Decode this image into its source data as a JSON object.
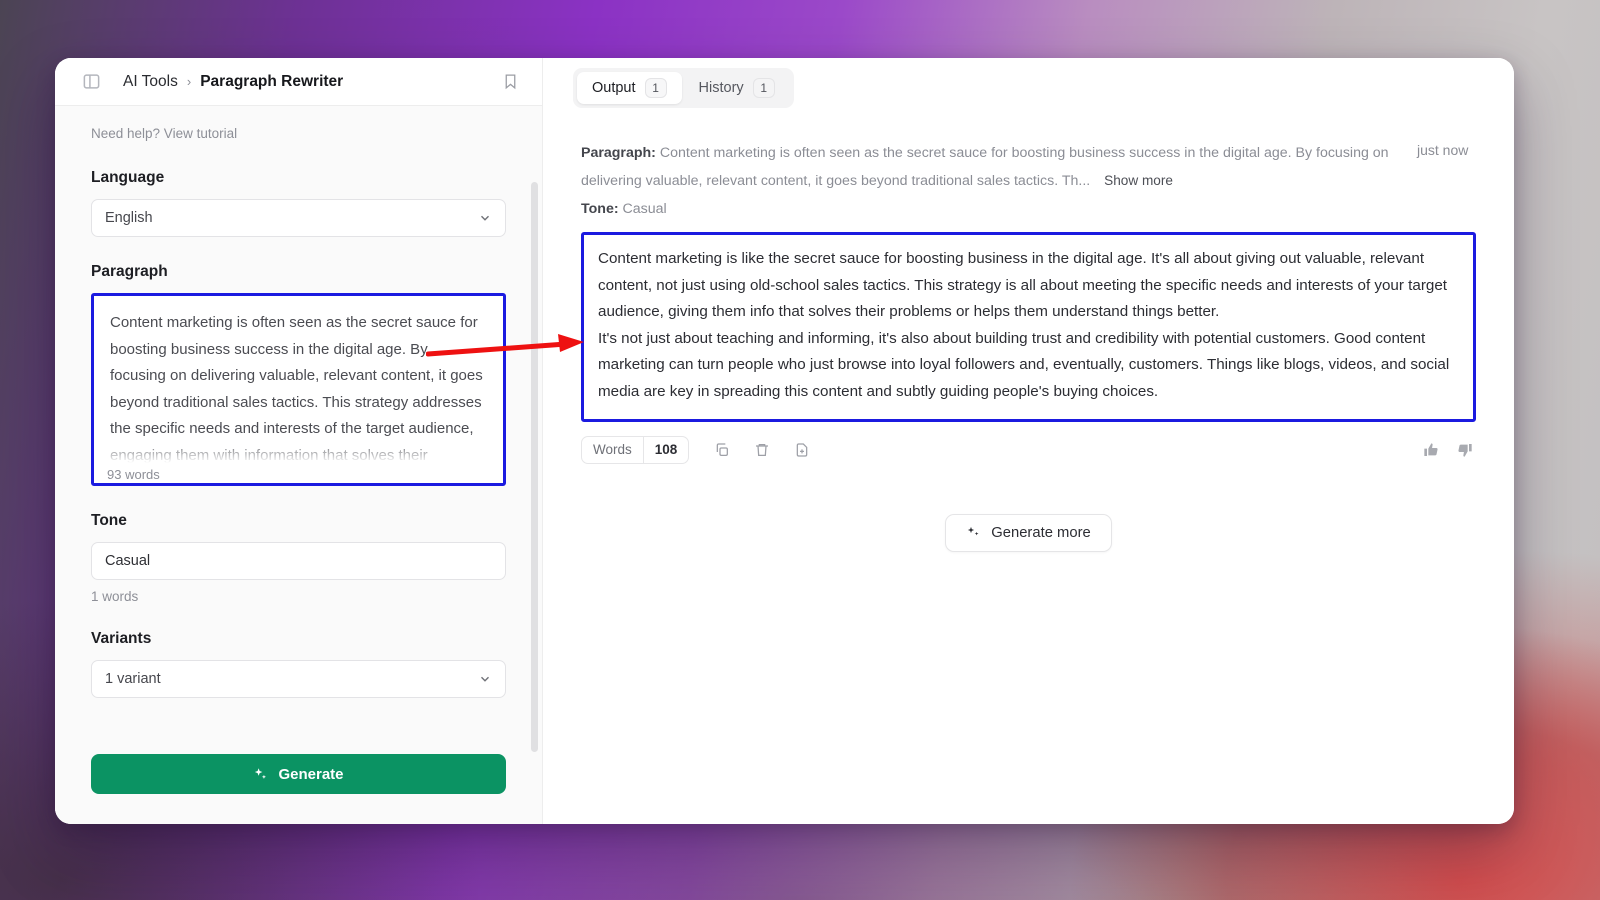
{
  "window": {
    "header": {
      "panel_toggle_icon": "sidebar-panel-icon",
      "breadcrumb_root": "AI Tools",
      "breadcrumb_separator": "›",
      "breadcrumb_current": "Paragraph Rewriter",
      "bookmark_icon": "bookmark-icon"
    }
  },
  "sidebar": {
    "tutorial_link": "Need help? View tutorial",
    "language": {
      "label": "Language",
      "value": "English",
      "chevron_icon": "chevron-down-icon"
    },
    "paragraph": {
      "label": "Paragraph",
      "value": "Content marketing is often seen as the secret sauce for boosting business success in the digital age. By focusing on delivering valuable, relevant content, it goes beyond traditional sales tactics. This strategy addresses the specific needs and interests of the target audience, engaging them with information that solves their",
      "word_count": "93 words"
    },
    "tone": {
      "label": "Tone",
      "value": "Casual",
      "word_count": "1 words"
    },
    "variants": {
      "label": "Variants",
      "value": "1 variant",
      "chevron_icon": "chevron-down-icon"
    },
    "generate_button": {
      "label": "Generate",
      "icon": "sparkle-icon",
      "color": "#0b9363"
    }
  },
  "output_panel": {
    "tabs": [
      {
        "label": "Output",
        "badge": "1",
        "active": true
      },
      {
        "label": "History",
        "badge": "1",
        "active": false
      }
    ],
    "meta": {
      "paragraph_label": "Paragraph:",
      "paragraph_preview": "Content marketing is often seen as the secret sauce for boosting business success in the digital age. By focusing on delivering valuable, relevant content, it goes beyond traditional sales tactics. Th...",
      "show_more": "Show more",
      "timestamp": "just now",
      "tone_label": "Tone:",
      "tone_value": "Casual"
    },
    "result": {
      "paragraph_1": "Content marketing is like the secret sauce for boosting business in the digital age. It's all about giving out valuable, relevant content, not just using old-school sales tactics. This strategy is all about meeting the specific needs and interests of your target audience, giving them info that solves their problems or helps them understand things better.",
      "paragraph_2": "It's not just about teaching and informing, it's also about building trust and credibility with potential customers. Good content marketing can turn people who just browse into loyal followers and, eventually, customers. Things like blogs, videos, and social media are key in spreading this content and subtly guiding people's buying choices."
    },
    "actions": {
      "words_label": "Words",
      "words_value": "108",
      "copy_icon": "copy-icon",
      "delete_icon": "trash-icon",
      "export_icon": "save-document-icon",
      "thumbs_up_icon": "thumbs-up-icon",
      "thumbs_down_icon": "thumbs-down-icon"
    },
    "generate_more": {
      "label": "Generate more",
      "icon": "sparkle-icon"
    }
  },
  "annotation": {
    "arrow_color": "#ee1111",
    "highlight_color": "#1b1ae0"
  }
}
